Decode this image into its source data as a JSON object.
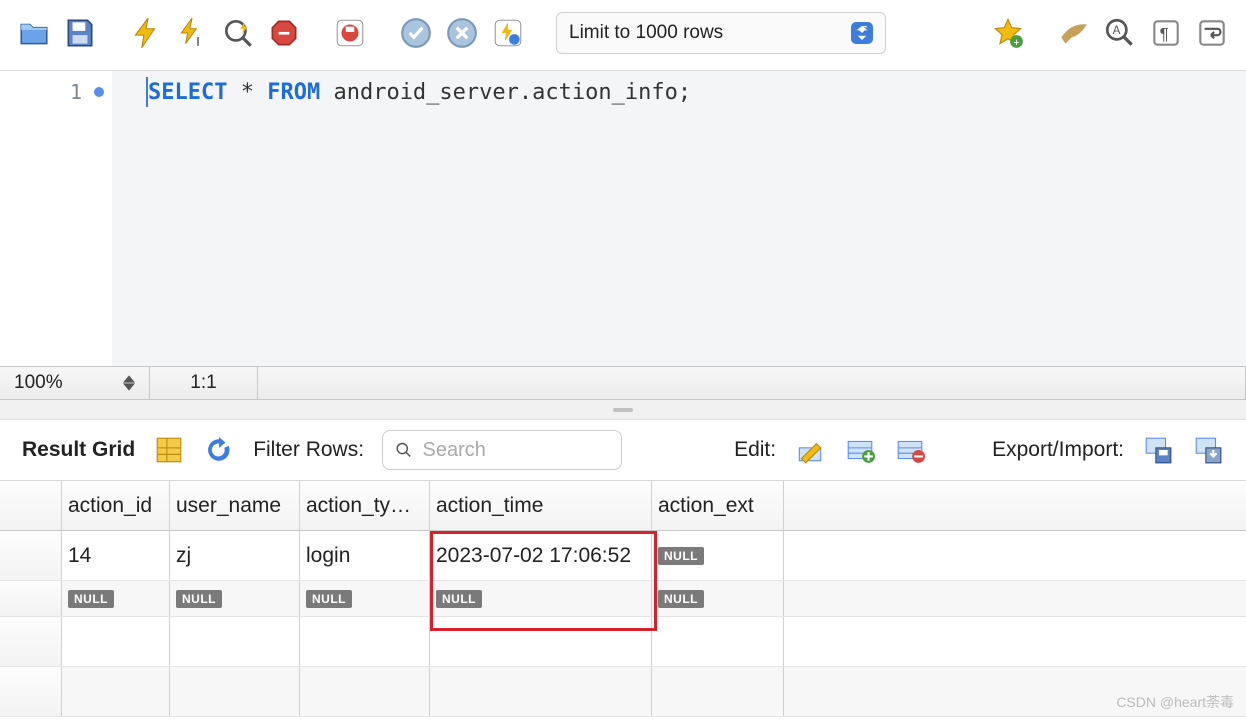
{
  "toolbar": {
    "limit_label": "Limit to 1000 rows"
  },
  "editor": {
    "line_number": "1",
    "kw1": "SELECT",
    "star": " * ",
    "kw2": "FROM",
    "rest": " android_server.action_info;"
  },
  "status": {
    "zoom": "100%",
    "position": "1:1"
  },
  "results": {
    "grid_label": "Result Grid",
    "filter_label": "Filter Rows:",
    "search_placeholder": "Search",
    "edit_label": "Edit:",
    "export_label": "Export/Import:"
  },
  "grid": {
    "headers": [
      "action_id",
      "user_name",
      "action_ty…",
      "action_time",
      "action_ext"
    ],
    "rows": [
      {
        "cells": [
          "14",
          "zj",
          "login",
          "2023-07-02 17:06:52",
          null
        ]
      },
      {
        "cells": [
          null,
          null,
          null,
          null,
          null
        ]
      }
    ]
  },
  "null_text": "NULL",
  "watermark": "CSDN @heart荼毒"
}
